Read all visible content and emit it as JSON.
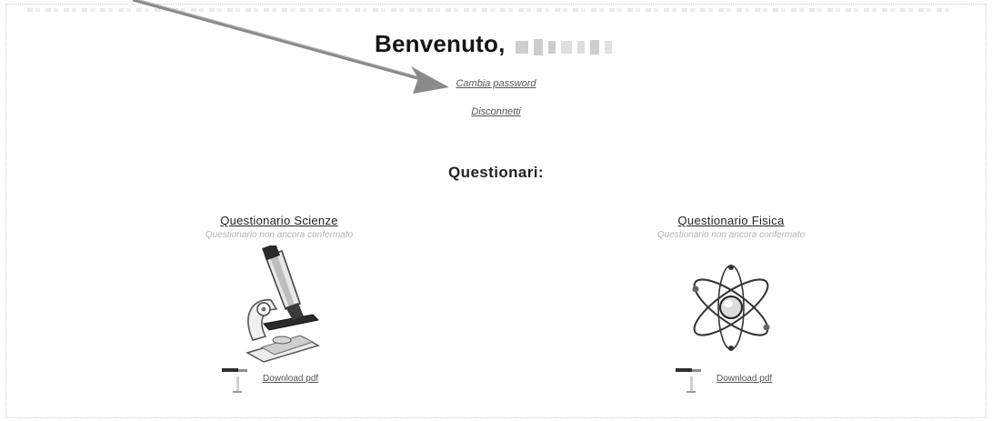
{
  "header": {
    "welcome": "Benvenuto,",
    "change_password": "Cambia password",
    "logout": "Disconnetti"
  },
  "main": {
    "section_title": "Questionari:",
    "questionnaires": [
      {
        "title": "Questionario Scienze",
        "subtitle": "Questionario non ancora confermato",
        "icon": "microscope-icon",
        "download_label": "Download pdf"
      },
      {
        "title": "Questionario Fisica",
        "subtitle": "Questionario non ancora confermato",
        "icon": "atom-icon",
        "download_label": "Download pdf"
      }
    ]
  },
  "colors": {
    "background": "#ffffff",
    "text": "#222222",
    "muted": "#b3b3b3",
    "annotation_arrow": "#8a8a8a"
  }
}
